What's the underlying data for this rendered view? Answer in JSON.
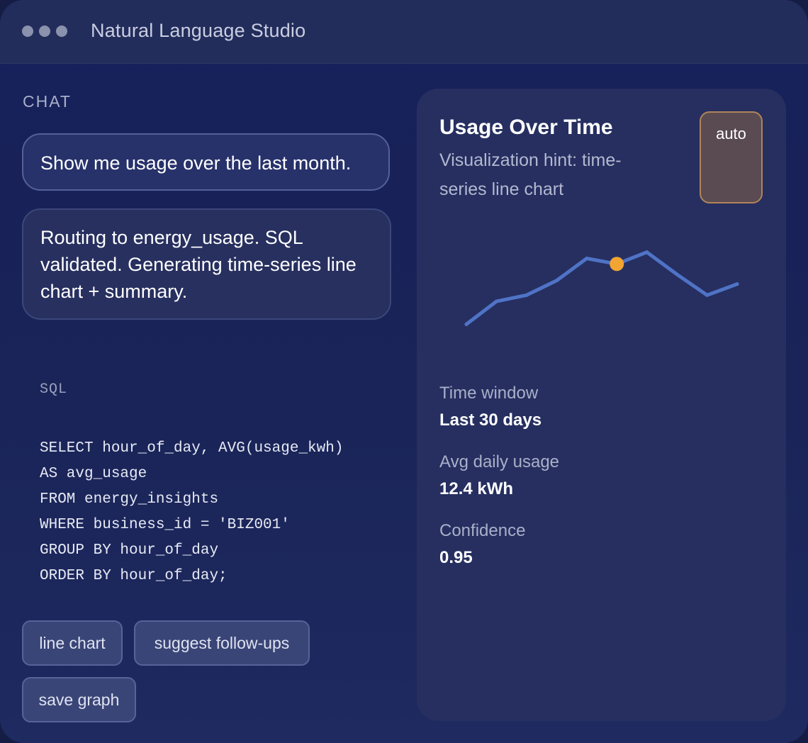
{
  "window": {
    "title": "Natural Language Studio"
  },
  "chat": {
    "section_label": "CHAT",
    "messages": [
      {
        "role": "user",
        "text": "Show me usage over the last month."
      },
      {
        "role": "assistant",
        "text": "Routing to energy_usage. SQL validated. Generating time-series line chart + summary."
      }
    ]
  },
  "sql": {
    "label": "SQL",
    "code": "SELECT hour_of_day, AVG(usage_kwh)\nAS avg_usage\nFROM energy_insights\nWHERE business_id = 'BIZ001'\nGROUP BY hour_of_day\nORDER BY hour_of_day;"
  },
  "actions": {
    "line_chart": "line chart",
    "suggest_followups": "suggest follow-ups",
    "save_graph": "save graph"
  },
  "panel": {
    "title": "Usage Over Time",
    "subtitle": "Visualization hint: time-series line chart",
    "auto_label": "auto",
    "stats": [
      {
        "label": "Time window",
        "value": "Last 30 days"
      },
      {
        "label": "Avg daily usage",
        "value": "12.4 kWh"
      },
      {
        "label": "Confidence",
        "value": "0.95"
      }
    ]
  },
  "chart_data": {
    "type": "line",
    "x": [
      1,
      2,
      3,
      4,
      5,
      6,
      7,
      8,
      9,
      10
    ],
    "values": [
      2,
      5.3,
      6.2,
      8.3,
      11.5,
      10.7,
      12.4,
      9.2,
      6.2,
      7.8
    ],
    "highlight_index": 5,
    "ylim": [
      0,
      14
    ],
    "line_color": "#4f73c6",
    "highlight_color": "#f2a533",
    "grid": false,
    "axes": false
  }
}
